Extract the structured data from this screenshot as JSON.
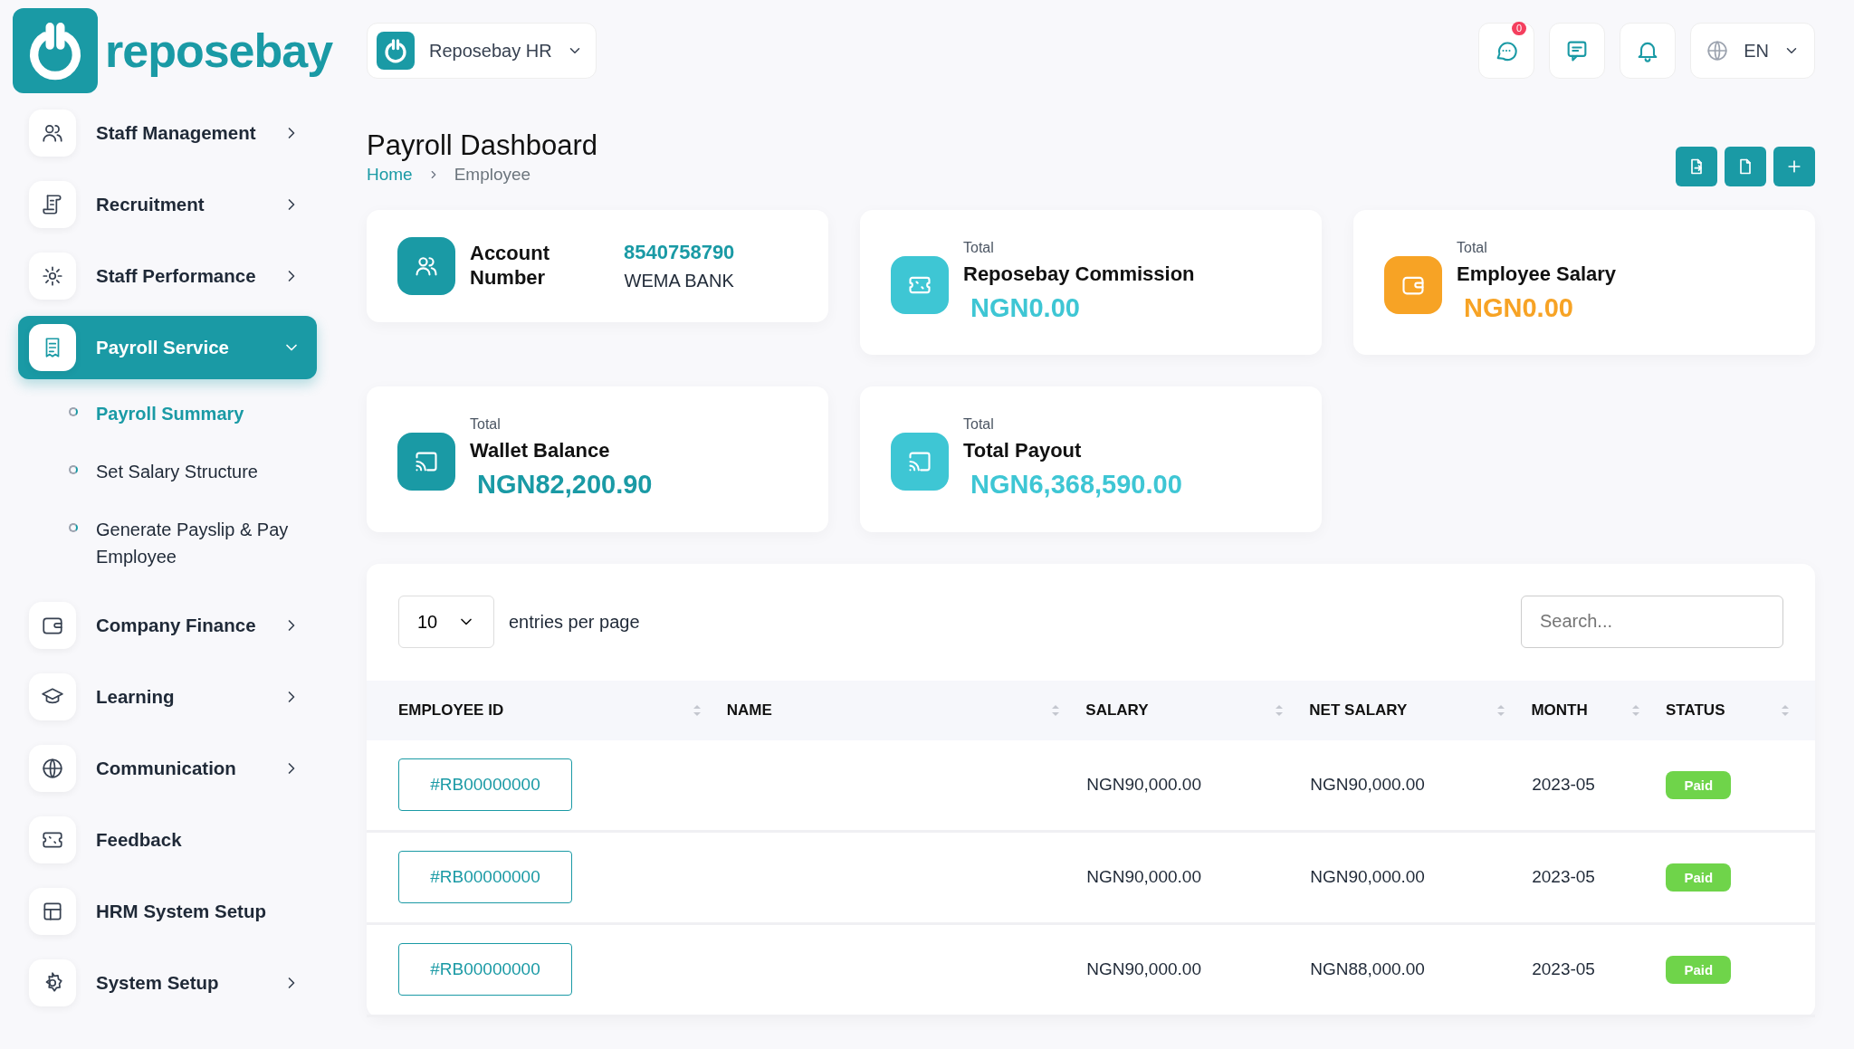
{
  "logo": {
    "text": "reposebay"
  },
  "company_switcher": {
    "label": "Reposebay HR"
  },
  "header": {
    "message_badge": "0",
    "language": "EN"
  },
  "sidebar": {
    "items": [
      {
        "label": "Staff Management",
        "selected": false,
        "expanded": false
      },
      {
        "label": "Recruitment",
        "selected": false,
        "expanded": false
      },
      {
        "label": "Staff Performance",
        "selected": false,
        "expanded": false
      },
      {
        "label": "Payroll Service",
        "selected": true,
        "expanded": true,
        "children": [
          {
            "label": "Payroll Summary",
            "selected": true
          },
          {
            "label": "Set Salary Structure",
            "selected": false
          },
          {
            "label": "Generate Payslip & Pay Employee",
            "selected": false
          }
        ]
      },
      {
        "label": "Company Finance",
        "selected": false,
        "expanded": false
      },
      {
        "label": "Learning",
        "selected": false,
        "expanded": false
      },
      {
        "label": "Communication",
        "selected": false,
        "expanded": false
      },
      {
        "label": "Feedback",
        "selected": false
      },
      {
        "label": "HRM System Setup",
        "selected": false
      },
      {
        "label": "System Setup",
        "selected": false,
        "expanded": false
      }
    ]
  },
  "page": {
    "title": "Payroll Dashboard",
    "breadcrumb": [
      {
        "label": "Home",
        "link": true
      },
      {
        "label": "Employee",
        "link": false
      }
    ],
    "actions": [
      {
        "kind": "export"
      },
      {
        "kind": "document"
      },
      {
        "kind": "add"
      }
    ]
  },
  "stats": [
    {
      "kind": "account",
      "color": "#1a9aa5",
      "label": "Account Number",
      "number": "8540758790",
      "bank": "WEMA BANK"
    },
    {
      "kind": "total",
      "color": "#3ec6d4",
      "caption": "Total",
      "label": "Reposebay Commission",
      "amount": "NGN0.00"
    },
    {
      "kind": "total",
      "color": "#f7a325",
      "caption": "Total",
      "label": "Employee Salary",
      "amount": "NGN0.00"
    },
    {
      "kind": "total",
      "color": "#1a9aa5",
      "caption": "Total",
      "label": "Wallet Balance",
      "amount": "NGN82,200.90"
    },
    {
      "kind": "total",
      "color": "#3ec6d4",
      "caption": "Total",
      "label": "Total Payout",
      "amount": "NGN6,368,590.00"
    }
  ],
  "table": {
    "page_size": "10",
    "page_size_label": "entries per page",
    "search": {
      "placeholder": "Search..."
    },
    "columns": [
      "EMPLOYEE ID",
      "NAME",
      "SALARY",
      "NET SALARY",
      "MONTH",
      "STATUS"
    ],
    "rows": [
      {
        "employee_id": "#RB00000000",
        "salary": "NGN90,000.00",
        "net_salary": "NGN90,000.00",
        "month": "2023-05",
        "status": "Paid"
      },
      {
        "employee_id": "#RB00000000",
        "salary": "NGN90,000.00",
        "net_salary": "NGN90,000.00",
        "month": "2023-05",
        "status": "Paid"
      },
      {
        "employee_id": "#RB00000000",
        "salary": "NGN90,000.00",
        "net_salary": "NGN88,000.00",
        "month": "2023-05",
        "status": "Paid"
      }
    ]
  }
}
